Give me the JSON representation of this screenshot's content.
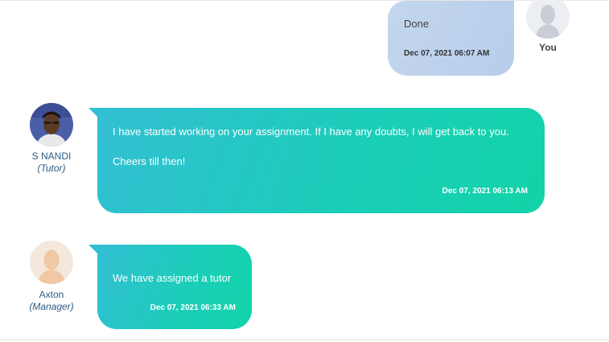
{
  "messages": [
    {
      "sender": "You",
      "text": "Done",
      "timestamp": "Dec 07, 2021 06:07 AM"
    },
    {
      "sender": "S NANDI",
      "role": "(Tutor)",
      "line1": "I have started working on your assignment. If I have any doubts, I will get back to you.",
      "line2": "Cheers till then!",
      "timestamp": "Dec 07, 2021 06:13 AM"
    },
    {
      "sender": "Axton",
      "role": "(Manager)",
      "text": "We have assigned a tutor",
      "timestamp": "Dec 07, 2021 06:33 AM"
    }
  ]
}
